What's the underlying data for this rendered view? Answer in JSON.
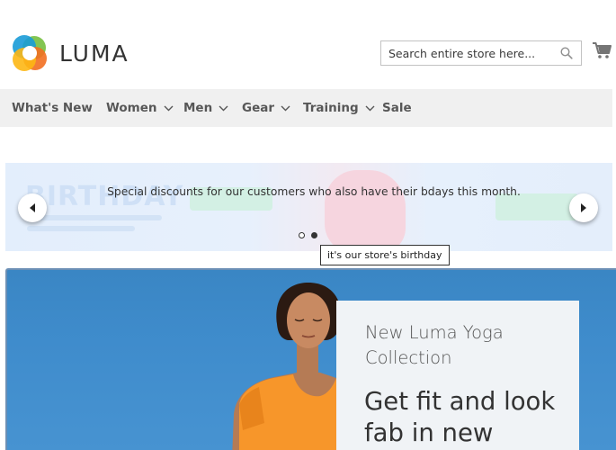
{
  "header": {
    "logo_text": "LUMA",
    "search": {
      "placeholder": "Search entire store here...",
      "value": ""
    },
    "icons": {
      "search": "search-icon",
      "cart": "cart-icon",
      "logo": "luma-logo-icon"
    }
  },
  "nav": {
    "items": [
      {
        "label": "What's New",
        "has_dropdown": false
      },
      {
        "label": "Women",
        "has_dropdown": true
      },
      {
        "label": "Men",
        "has_dropdown": true
      },
      {
        "label": "Gear",
        "has_dropdown": true
      },
      {
        "label": "Training",
        "has_dropdown": true
      },
      {
        "label": "Sale",
        "has_dropdown": false
      }
    ]
  },
  "banner": {
    "caption": "Special discounts for our customers who also have their bdays this month.",
    "tooltip": "it's our store's birthday",
    "slides_total": 2,
    "active_slide": 2
  },
  "hero": {
    "subtitle": "New Luma Yoga Collection",
    "title": "Get fit and look fab in new"
  },
  "colors": {
    "nav_background": "#f0f0f0",
    "hero_sky": "#3f8ccc",
    "hero_panel": "#f0f3f6",
    "model_top": "#f7962a",
    "logo_green": "#78c043",
    "logo_blue": "#1a9bd7",
    "logo_orange": "#f26f21",
    "logo_yellow": "#fdb714"
  }
}
